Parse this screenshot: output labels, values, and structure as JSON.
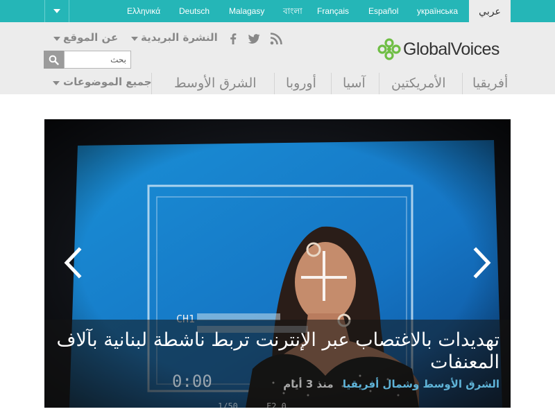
{
  "languages": [
    {
      "label": "Ελληνικά"
    },
    {
      "label": "Deutsch"
    },
    {
      "label": "Malagasy"
    },
    {
      "label": "বাংলা"
    },
    {
      "label": "Français"
    },
    {
      "label": "Español"
    },
    {
      "label": "українська"
    }
  ],
  "active_language": "عربي",
  "logo": {
    "brand_first": "Global",
    "brand_second": "Voices"
  },
  "header_links": {
    "about": "عن الموقع",
    "newsletter": "النشرة البريدية"
  },
  "social_icons": [
    "facebook-icon",
    "twitter-icon",
    "rss-icon"
  ],
  "search": {
    "placeholder": "بحث"
  },
  "regions": [
    "أفريقيا",
    "الأمريكتين",
    "آسيا",
    "أوروبا",
    "الشرق الأوسط"
  ],
  "all_topics": "جميع الموضوعات",
  "featured": {
    "headline": "تهديدات بالاغتصاب عبر الإنترنت تربط ناشطة لبنانية بآلاف المعنفات",
    "category": "الشرق الأوسط وشمال أفريقيا",
    "time_ago": "منذ 3 أيام",
    "screen_text": {
      "channel": "CH1",
      "timecode": "0:00",
      "lens": "1/50",
      "fstop": "F2.0"
    }
  },
  "colors": {
    "accent": "#25b6b7",
    "header_bg": "#ececec",
    "link_blue": "#5fb3d7",
    "logo_green": "#6fbe44"
  }
}
